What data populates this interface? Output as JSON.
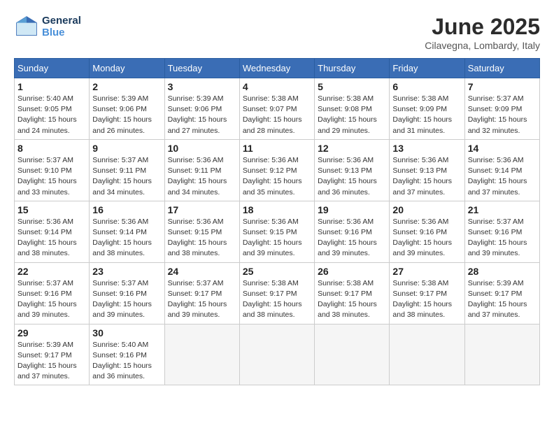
{
  "logo": {
    "line1": "General",
    "line2": "Blue"
  },
  "title": "June 2025",
  "subtitle": "Cilavegna, Lombardy, Italy",
  "weekdays": [
    "Sunday",
    "Monday",
    "Tuesday",
    "Wednesday",
    "Thursday",
    "Friday",
    "Saturday"
  ],
  "weeks": [
    [
      {
        "day": "1",
        "info": "Sunrise: 5:40 AM\nSunset: 9:05 PM\nDaylight: 15 hours\nand 24 minutes."
      },
      {
        "day": "2",
        "info": "Sunrise: 5:39 AM\nSunset: 9:06 PM\nDaylight: 15 hours\nand 26 minutes."
      },
      {
        "day": "3",
        "info": "Sunrise: 5:39 AM\nSunset: 9:06 PM\nDaylight: 15 hours\nand 27 minutes."
      },
      {
        "day": "4",
        "info": "Sunrise: 5:38 AM\nSunset: 9:07 PM\nDaylight: 15 hours\nand 28 minutes."
      },
      {
        "day": "5",
        "info": "Sunrise: 5:38 AM\nSunset: 9:08 PM\nDaylight: 15 hours\nand 29 minutes."
      },
      {
        "day": "6",
        "info": "Sunrise: 5:38 AM\nSunset: 9:09 PM\nDaylight: 15 hours\nand 31 minutes."
      },
      {
        "day": "7",
        "info": "Sunrise: 5:37 AM\nSunset: 9:09 PM\nDaylight: 15 hours\nand 32 minutes."
      }
    ],
    [
      {
        "day": "8",
        "info": "Sunrise: 5:37 AM\nSunset: 9:10 PM\nDaylight: 15 hours\nand 33 minutes."
      },
      {
        "day": "9",
        "info": "Sunrise: 5:37 AM\nSunset: 9:11 PM\nDaylight: 15 hours\nand 34 minutes."
      },
      {
        "day": "10",
        "info": "Sunrise: 5:36 AM\nSunset: 9:11 PM\nDaylight: 15 hours\nand 34 minutes."
      },
      {
        "day": "11",
        "info": "Sunrise: 5:36 AM\nSunset: 9:12 PM\nDaylight: 15 hours\nand 35 minutes."
      },
      {
        "day": "12",
        "info": "Sunrise: 5:36 AM\nSunset: 9:13 PM\nDaylight: 15 hours\nand 36 minutes."
      },
      {
        "day": "13",
        "info": "Sunrise: 5:36 AM\nSunset: 9:13 PM\nDaylight: 15 hours\nand 37 minutes."
      },
      {
        "day": "14",
        "info": "Sunrise: 5:36 AM\nSunset: 9:14 PM\nDaylight: 15 hours\nand 37 minutes."
      }
    ],
    [
      {
        "day": "15",
        "info": "Sunrise: 5:36 AM\nSunset: 9:14 PM\nDaylight: 15 hours\nand 38 minutes."
      },
      {
        "day": "16",
        "info": "Sunrise: 5:36 AM\nSunset: 9:14 PM\nDaylight: 15 hours\nand 38 minutes."
      },
      {
        "day": "17",
        "info": "Sunrise: 5:36 AM\nSunset: 9:15 PM\nDaylight: 15 hours\nand 38 minutes."
      },
      {
        "day": "18",
        "info": "Sunrise: 5:36 AM\nSunset: 9:15 PM\nDaylight: 15 hours\nand 39 minutes."
      },
      {
        "day": "19",
        "info": "Sunrise: 5:36 AM\nSunset: 9:16 PM\nDaylight: 15 hours\nand 39 minutes."
      },
      {
        "day": "20",
        "info": "Sunrise: 5:36 AM\nSunset: 9:16 PM\nDaylight: 15 hours\nand 39 minutes."
      },
      {
        "day": "21",
        "info": "Sunrise: 5:37 AM\nSunset: 9:16 PM\nDaylight: 15 hours\nand 39 minutes."
      }
    ],
    [
      {
        "day": "22",
        "info": "Sunrise: 5:37 AM\nSunset: 9:16 PM\nDaylight: 15 hours\nand 39 minutes."
      },
      {
        "day": "23",
        "info": "Sunrise: 5:37 AM\nSunset: 9:16 PM\nDaylight: 15 hours\nand 39 minutes."
      },
      {
        "day": "24",
        "info": "Sunrise: 5:37 AM\nSunset: 9:17 PM\nDaylight: 15 hours\nand 39 minutes."
      },
      {
        "day": "25",
        "info": "Sunrise: 5:38 AM\nSunset: 9:17 PM\nDaylight: 15 hours\nand 38 minutes."
      },
      {
        "day": "26",
        "info": "Sunrise: 5:38 AM\nSunset: 9:17 PM\nDaylight: 15 hours\nand 38 minutes."
      },
      {
        "day": "27",
        "info": "Sunrise: 5:38 AM\nSunset: 9:17 PM\nDaylight: 15 hours\nand 38 minutes."
      },
      {
        "day": "28",
        "info": "Sunrise: 5:39 AM\nSunset: 9:17 PM\nDaylight: 15 hours\nand 37 minutes."
      }
    ],
    [
      {
        "day": "29",
        "info": "Sunrise: 5:39 AM\nSunset: 9:17 PM\nDaylight: 15 hours\nand 37 minutes."
      },
      {
        "day": "30",
        "info": "Sunrise: 5:40 AM\nSunset: 9:16 PM\nDaylight: 15 hours\nand 36 minutes."
      },
      {
        "day": "",
        "info": ""
      },
      {
        "day": "",
        "info": ""
      },
      {
        "day": "",
        "info": ""
      },
      {
        "day": "",
        "info": ""
      },
      {
        "day": "",
        "info": ""
      }
    ]
  ]
}
